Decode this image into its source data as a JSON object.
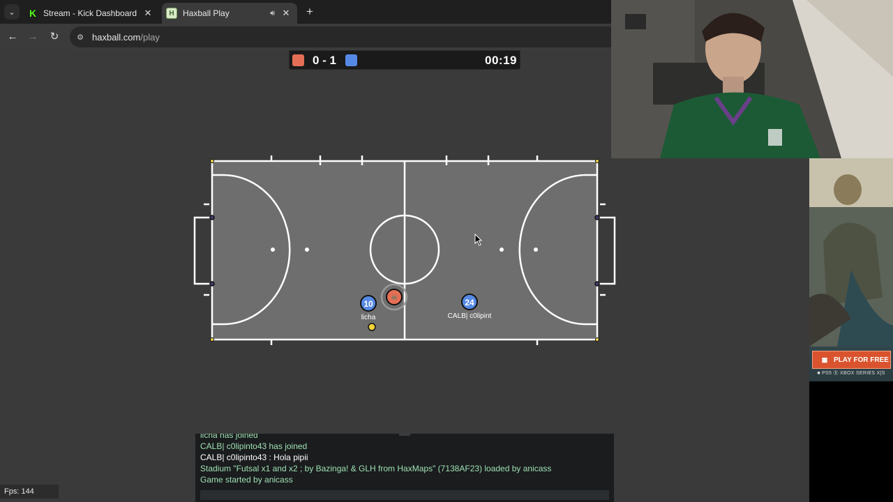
{
  "browser": {
    "tabs": [
      {
        "title": "Stream - Kick Dashboard",
        "favicon": "K",
        "active": false
      },
      {
        "title": "Haxball Play",
        "favicon": "H",
        "active": true
      }
    ],
    "url_host": "haxball.com",
    "url_path": "/play"
  },
  "scoreboard": {
    "score": "0 - 1",
    "timer": "00:19",
    "colors": {
      "red": "#e56e56",
      "blue": "#5689e5"
    }
  },
  "players": [
    {
      "avatar": "10",
      "name": "licha",
      "team": "blue"
    },
    {
      "avatar": "24",
      "name": "CALB| c0lipint",
      "team": "blue"
    },
    {
      "avatar": "☠",
      "name": "",
      "team": "red"
    }
  ],
  "chat": {
    "messages": [
      {
        "text": "licha has joined",
        "kind": "notice"
      },
      {
        "text": "CALB| c0lipinto43 has joined",
        "kind": "notice"
      },
      {
        "text": "CALB| c0lipinto43 : Hola pipii",
        "kind": "chat"
      },
      {
        "text": "Stadium \"Futsal x1 and x2 ; by Bazinga! & GLH from HaxMaps\" (7138AF23) loaded by anicass",
        "kind": "notice"
      },
      {
        "text": "Game started by anicass",
        "kind": "notice"
      }
    ],
    "input_value": ""
  },
  "fps": "Fps: 144",
  "ad": {
    "cta": "PLAY FOR FREE",
    "platforms": "■ PS5   Ⓧ XBOX SERIES X|S"
  }
}
